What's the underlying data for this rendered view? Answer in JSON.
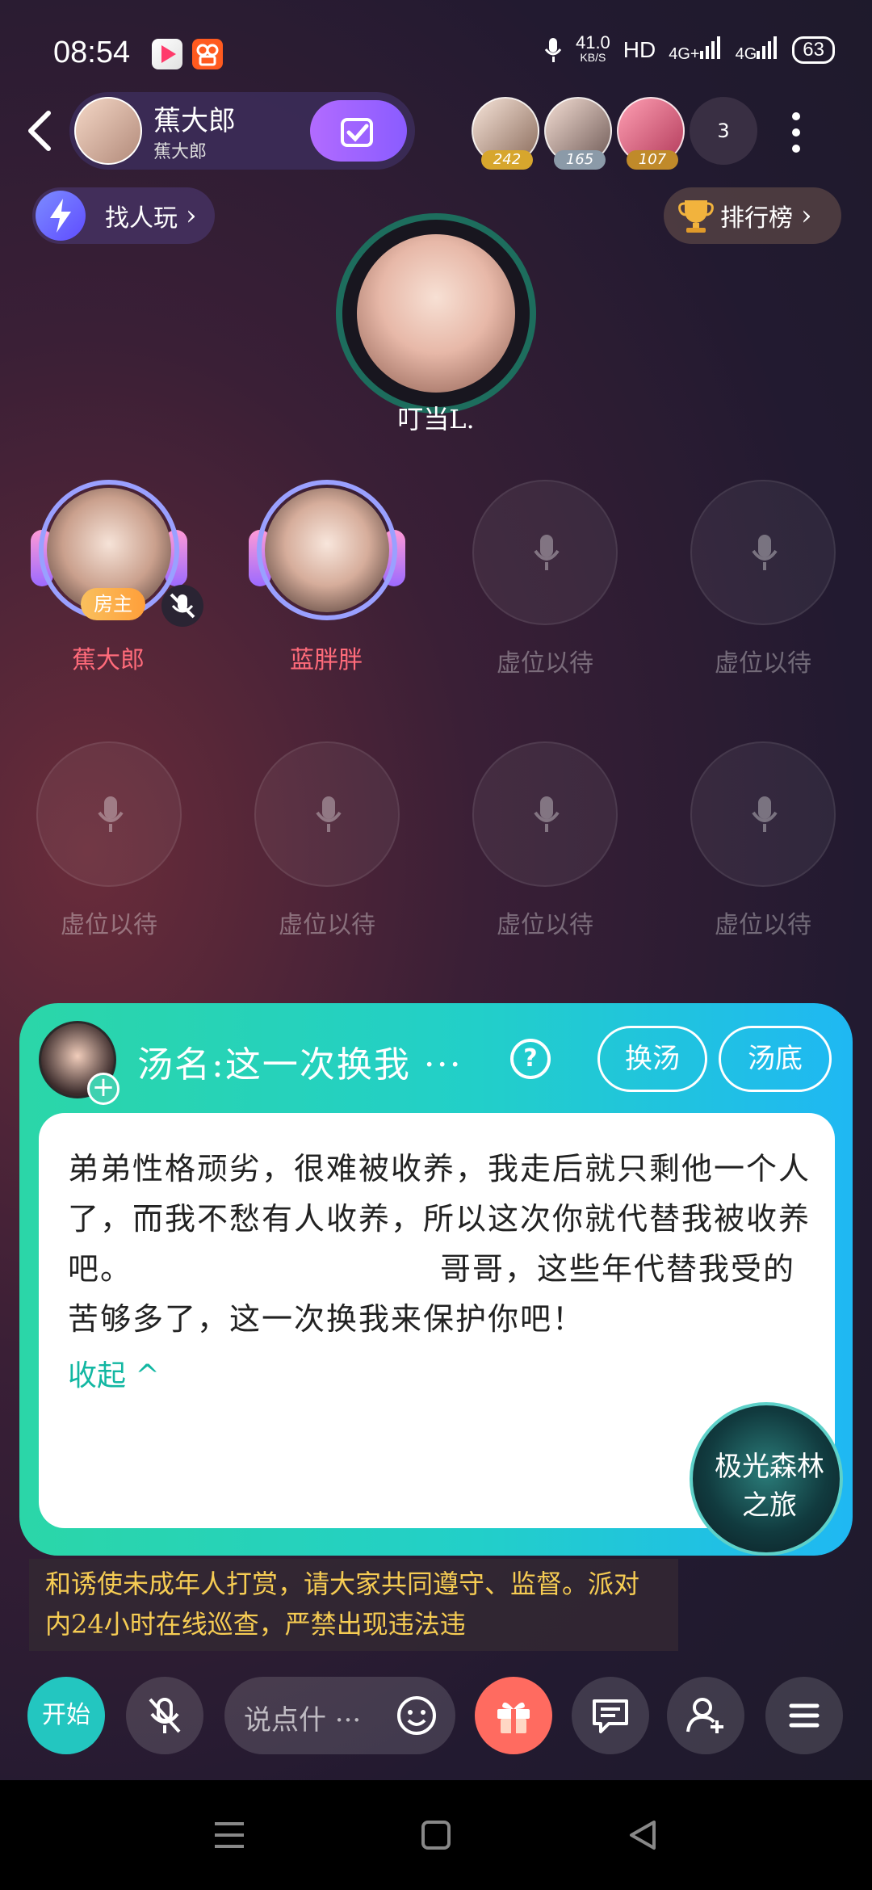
{
  "status_bar": {
    "time": "08:54",
    "net_speed_value": "41.0",
    "net_speed_unit": "KB/S",
    "hd": "HD",
    "signal_1": "4G+",
    "signal_2": "4G",
    "battery": "63"
  },
  "header": {
    "room_name": "蕉大郎",
    "room_subtitle": "蕉大郎",
    "viewers": [
      {
        "count": "242",
        "color": "#d7a62d"
      },
      {
        "count": "165",
        "color": "#8b9aa8"
      },
      {
        "count": "107",
        "color": "#c08a2a"
      }
    ],
    "more_count": "3"
  },
  "actions": {
    "find_players": "找人玩",
    "leaderboard": "排行榜"
  },
  "host": {
    "name": "叮当L."
  },
  "seats": {
    "user_1": {
      "name": "蕉大郎",
      "badge": "房主"
    },
    "user_2": {
      "name": "蓝胖胖"
    },
    "empty_label": "虚位以待"
  },
  "soup_card": {
    "title": "汤名:这一次换我 ···",
    "help": "?",
    "swap_button": "换汤",
    "answer_button": "汤底",
    "story": "弟弟性格顽劣，很难被收养，我走后就只剩他一个人了，而我不愁有人收养，所以这次你就代替我被收养吧。　　　　　　　　　　哥哥，这些年代替我受的苦够多了，这一次换我来保护你吧！",
    "collapse": "收起 ^",
    "game_logo_line1": "极光森林",
    "game_logo_line2": "之旅"
  },
  "notice": "和诱使未成年人打赏，请大家共同遵守、监督。派对内24小时在线巡查，严禁出现违法违",
  "bottom_bar": {
    "start": "开始",
    "input_placeholder": "说点什 ···"
  },
  "colors": {
    "accent_teal": "#2bd6a8",
    "accent_blue": "#1fb8f3",
    "notice_yellow": "#f6cc53",
    "seat_name_pink": "#ff6b7a"
  }
}
